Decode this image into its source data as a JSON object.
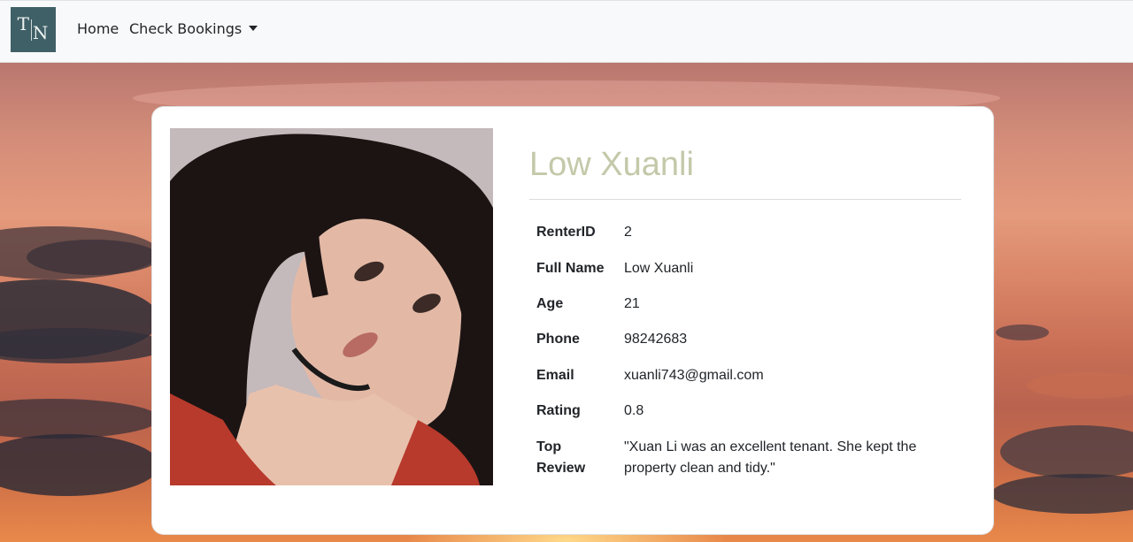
{
  "navbar": {
    "logo_text_left": "T",
    "logo_text_right": "N",
    "home_label": "Home",
    "bookings_label": "Check Bookings"
  },
  "profile": {
    "name": "Low Xuanli",
    "photo_alt": "Profile photo",
    "fields": [
      {
        "label": "RenterID",
        "value": "2"
      },
      {
        "label": "Full Name",
        "value": "Low Xuanli"
      },
      {
        "label": "Age",
        "value": "21"
      },
      {
        "label": "Phone",
        "value": "98242683"
      },
      {
        "label": "Email",
        "value": "xuanli743@gmail.com"
      },
      {
        "label": "Rating",
        "value": "0.8"
      },
      {
        "label": "Top Review",
        "value": "\"Xuan Li was an excellent tenant. She kept the property clean and tidy.\""
      }
    ]
  },
  "colors": {
    "brand": "#3f6066",
    "name_accent": "#c3c9a9",
    "navbar_bg": "#f8f9fa"
  }
}
